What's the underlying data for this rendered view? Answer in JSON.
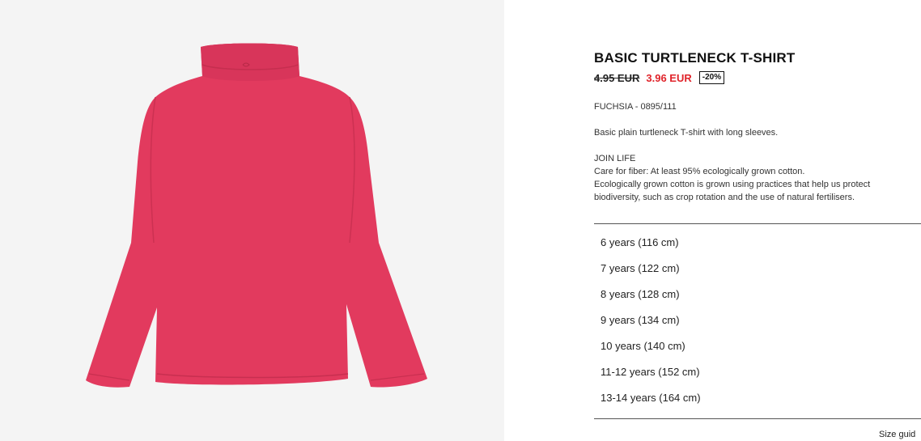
{
  "product": {
    "title": "BASIC TURTLENECK T-SHIRT",
    "price_old": "4.95 EUR",
    "price_new": "3.96 EUR",
    "discount": "-20%",
    "color_ref": "FUCHSIA - 0895/111",
    "description": "Basic plain turtleneck T-shirt with long sleeves.",
    "care_title": "JOIN LIFE",
    "care_line1": "Care for fiber: At least 95% ecologically grown cotton.",
    "care_line2": "Ecologically grown cotton is grown using practices that help us protect",
    "care_line3": "biodiversity, such as crop rotation and the use of natural fertilisers.",
    "image_icon": "turtleneck-shirt-photo"
  },
  "sizes": [
    "6 years (116 cm)",
    "7 years (122 cm)",
    "8 years (128 cm)",
    "9 years (134 cm)",
    "10 years (140 cm)",
    "11-12 years (152 cm)",
    "13-14 years (164 cm)"
  ],
  "size_guide_label": "Size guid",
  "colors": {
    "shirt": "#e23a5e",
    "sale_price": "#e0242b",
    "image_background": "#f4f4f4"
  }
}
